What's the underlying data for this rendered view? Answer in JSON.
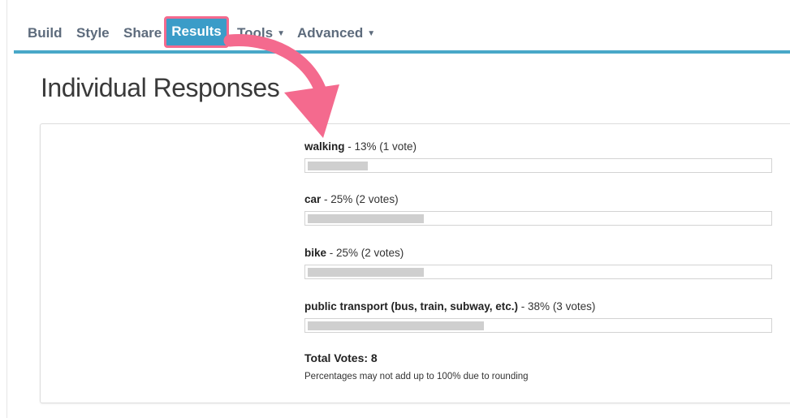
{
  "nav": {
    "items": [
      {
        "label": "Build"
      },
      {
        "label": "Style"
      },
      {
        "label": "Share"
      },
      {
        "label": "Results"
      },
      {
        "label": "Tools"
      },
      {
        "label": "Advanced"
      }
    ],
    "active": "Results"
  },
  "page": {
    "title": "Individual Responses"
  },
  "results": {
    "options": [
      {
        "name": "walking",
        "detail": " - 13% (1 vote)",
        "percent": 13
      },
      {
        "name": "car",
        "detail": " - 25% (2 votes)",
        "percent": 25
      },
      {
        "name": "bike",
        "detail": " - 25% (2 votes)",
        "percent": 25
      },
      {
        "name": "public transport (bus, train, subway, etc.)",
        "detail": " - 38% (3 votes)",
        "percent": 38
      }
    ],
    "total_votes": "Total Votes: 8",
    "footnote": "Percentages may not add up to 100% due to rounding"
  },
  "colors": {
    "accent": "#3b9cc8",
    "highlight": "#f46a8e",
    "bar_fill": "#cfcfcf"
  },
  "icons": {
    "annotation": "curved-arrow-icon",
    "dropdown": "caret-down-icon"
  }
}
